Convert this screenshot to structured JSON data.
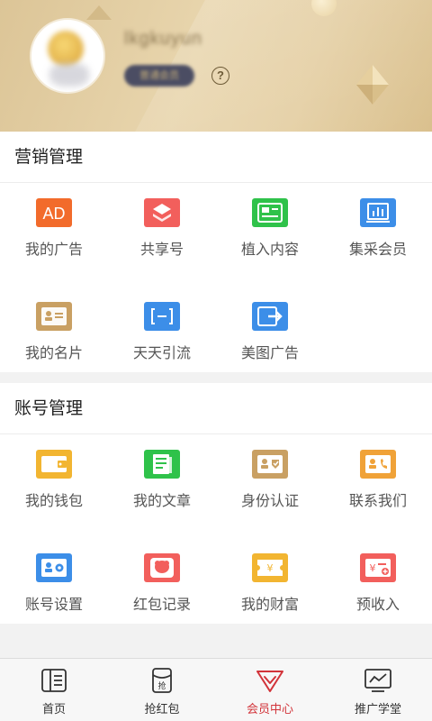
{
  "profile": {
    "username": "lkgkuyun",
    "vip_badge": "普通会员"
  },
  "marketing": {
    "title": "营销管理",
    "items": [
      {
        "label": "我的广告",
        "icon": "ad-icon",
        "color": "#f26b2b"
      },
      {
        "label": "共享号",
        "icon": "share-icon",
        "color": "#f25f5c"
      },
      {
        "label": "植入内容",
        "icon": "embed-content-icon",
        "color": "#2fc24a"
      },
      {
        "label": "集采会员",
        "icon": "chart-icon",
        "color": "#3c8ee8"
      },
      {
        "label": "我的名片",
        "icon": "business-card-icon",
        "color": "#c9a063"
      },
      {
        "label": "天天引流",
        "icon": "traffic-icon",
        "color": "#3c8ee8"
      },
      {
        "label": "美图广告",
        "icon": "image-ad-icon",
        "color": "#3c8ee8"
      }
    ]
  },
  "account": {
    "title": "账号管理",
    "items": [
      {
        "label": "我的钱包",
        "icon": "wallet-icon",
        "color": "#f2b531"
      },
      {
        "label": "我的文章",
        "icon": "article-icon",
        "color": "#2fc24a"
      },
      {
        "label": "身份认证",
        "icon": "id-verify-icon",
        "color": "#c9a063"
      },
      {
        "label": "联系我们",
        "icon": "contact-icon",
        "color": "#f0a238"
      },
      {
        "label": "账号设置",
        "icon": "account-settings-icon",
        "color": "#3c8ee8"
      },
      {
        "label": "红包记录",
        "icon": "red-packet-record-icon",
        "color": "#f25f5c"
      },
      {
        "label": "我的财富",
        "icon": "wealth-icon",
        "color": "#f2b531"
      },
      {
        "label": "预收入",
        "icon": "pre-income-icon",
        "color": "#f25f5c"
      }
    ]
  },
  "tabbar": {
    "items": [
      {
        "label": "首页",
        "icon": "home-icon"
      },
      {
        "label": "抢红包",
        "icon": "grab-red-packet-icon"
      },
      {
        "label": "会员中心",
        "icon": "member-center-icon",
        "active": true
      },
      {
        "label": "推广学堂",
        "icon": "promo-school-icon"
      }
    ],
    "active_color": "#d2343a"
  }
}
